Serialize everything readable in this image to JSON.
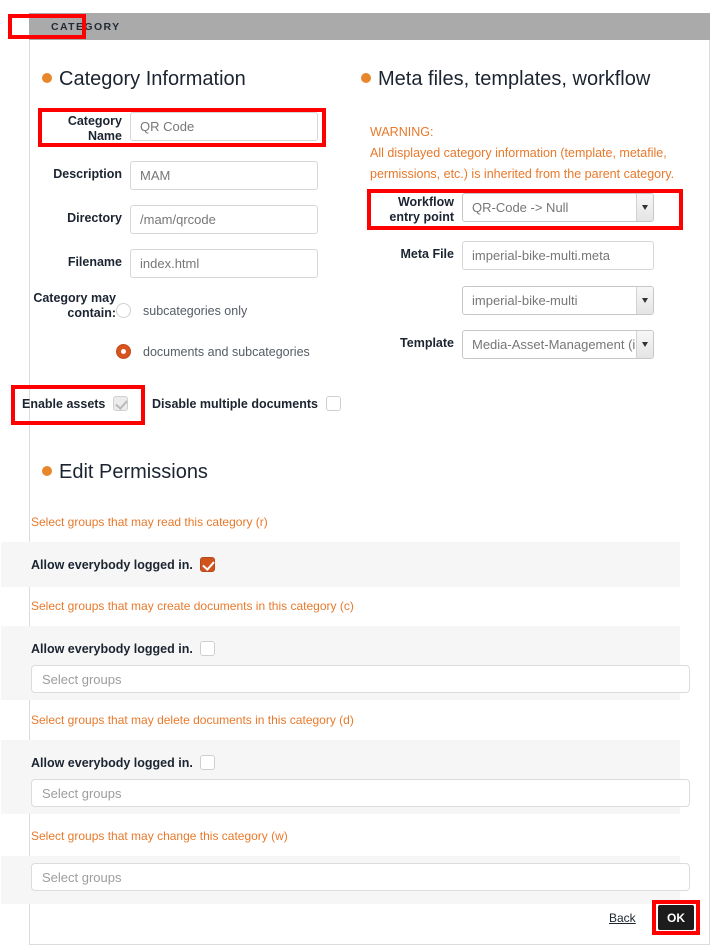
{
  "window": {
    "tab_label": "CATEGORY"
  },
  "category_information": {
    "heading": "Category Information",
    "fields": {
      "category_name": {
        "label_line1": "Category",
        "label_line2": "Name",
        "value": "QR Code"
      },
      "description": {
        "label": "Description",
        "value": "MAM"
      },
      "directory": {
        "label": "Directory",
        "value": "/mam/qrcode"
      },
      "filename": {
        "label": "Filename",
        "value": "index.html"
      }
    },
    "may_contain": {
      "label_line1": "Category may",
      "label_line2": "contain:",
      "options": [
        {
          "label": "subcategories only",
          "selected": false
        },
        {
          "label": "documents and subcategories",
          "selected": true
        }
      ]
    },
    "toggles": [
      {
        "label": "Enable assets",
        "checked": true,
        "disabled": true
      },
      {
        "label": "Disable multiple documents",
        "checked": false,
        "disabled": false
      }
    ]
  },
  "meta_section": {
    "heading": "Meta files, templates, workflow",
    "warning_title": "WARNING:",
    "warning_line1": "All displayed category information (template, metafile,",
    "warning_line2": "permissions, etc.) is inherited from the parent category.",
    "workflow": {
      "label_line1": "Workflow",
      "label_line2": "entry point",
      "value": "QR-Code -> Null"
    },
    "meta_file": {
      "label": "Meta File",
      "value": "imperial-bike-multi.meta"
    },
    "meta_select": {
      "value": "imperial-bike-multi"
    },
    "template": {
      "label": "Template",
      "value": "Media-Asset-Management (i"
    }
  },
  "permissions": {
    "heading": "Edit Permissions",
    "allow_label": "Allow everybody logged in.",
    "groups_placeholder": "Select groups",
    "sections": [
      {
        "hint": "Select groups that may read this category (r)",
        "allow_checked": true,
        "has_groups_input": false
      },
      {
        "hint": "Select groups that may create documents in this category (c)",
        "allow_checked": false,
        "has_groups_input": true
      },
      {
        "hint": "Select groups that may delete documents in this category (d)",
        "allow_checked": false,
        "has_groups_input": true
      },
      {
        "hint": "Select groups that may change this category (w)",
        "allow_checked": null,
        "has_groups_input": true
      }
    ]
  },
  "footer": {
    "back_label": "Back",
    "ok_label": "OK"
  },
  "colors": {
    "accent_orange": "#e8862b",
    "hint_orange": "#e8792b",
    "radio_selected": "#d9531e",
    "checkbox_checked": "#d1541f",
    "topbar_grey": "#aaaaaa",
    "annotation_red": "#ff0000",
    "ok_button": "#1c1c1c"
  }
}
